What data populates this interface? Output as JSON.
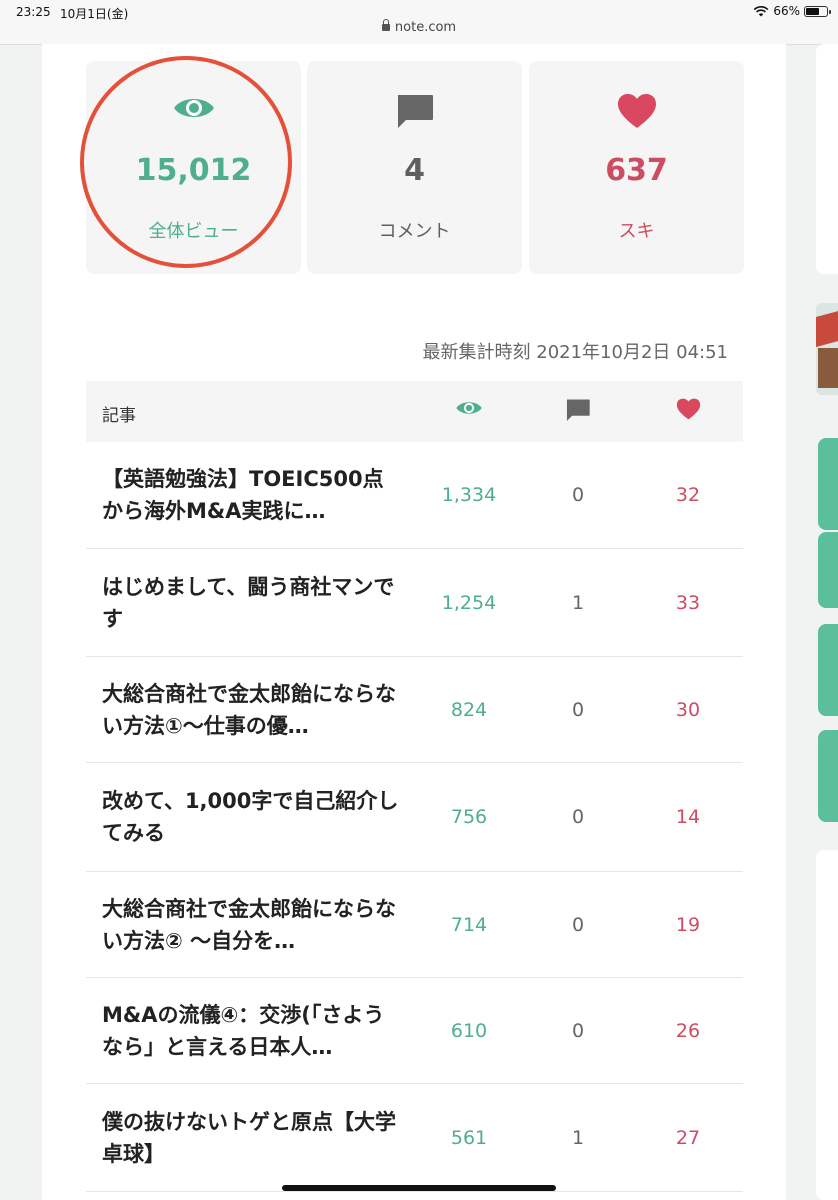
{
  "status_bar": {
    "time": "23:25",
    "date": "10月1日(金)",
    "url": "note.com",
    "battery": "66%"
  },
  "stats": {
    "views": {
      "value": "15,012",
      "label": "全体ビュー",
      "icon": "eye-icon"
    },
    "comments": {
      "value": "4",
      "label": "コメント",
      "icon": "speech-bubble-icon"
    },
    "likes": {
      "value": "637",
      "label": "スキ",
      "icon": "heart-icon"
    }
  },
  "last_updated": "最新集計時刻 2021年10月2日 04:51",
  "table": {
    "title_header": "記事",
    "header_icons": [
      "eye-icon",
      "speech-bubble-icon",
      "heart-icon"
    ],
    "rows": [
      {
        "title": "【英語勉強法】TOEIC500点から海外M&A実践に…",
        "views": "1,334",
        "comments": "0",
        "likes": "32"
      },
      {
        "title": "はじめまして、闘う商社マンです",
        "views": "1,254",
        "comments": "1",
        "likes": "33"
      },
      {
        "title": "大総合商社で金太郎飴にならない方法①〜仕事の優…",
        "views": "824",
        "comments": "0",
        "likes": "30"
      },
      {
        "title": "改めて、1,000字で自己紹介してみる",
        "views": "756",
        "comments": "0",
        "likes": "14"
      },
      {
        "title": "大総合商社で金太郎飴にならない方法② 〜自分を…",
        "views": "714",
        "comments": "0",
        "likes": "19"
      },
      {
        "title": "M&Aの流儀④：交渉(「さようなら」と言える日本人…",
        "views": "610",
        "comments": "0",
        "likes": "26"
      },
      {
        "title": "僕の抜けないトゲと原点【大学卓球】",
        "views": "561",
        "comments": "1",
        "likes": "27"
      }
    ]
  },
  "colors": {
    "accent_green": "#4fae8c",
    "accent_red": "#cc4d62",
    "highlight_circle": "#e4503a"
  }
}
